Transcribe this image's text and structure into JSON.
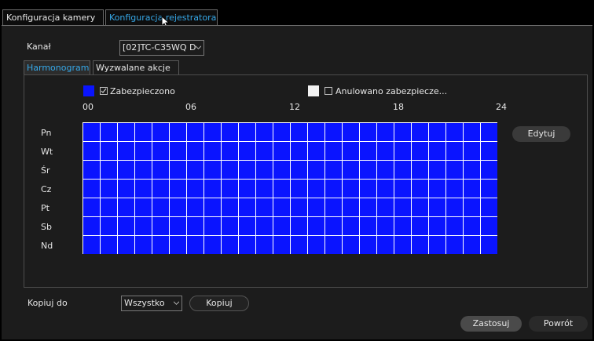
{
  "tabs": [
    {
      "label": "Konfiguracja kamery",
      "active": false
    },
    {
      "label": "Konfiguracja rejestratora",
      "active": true
    }
  ],
  "channel": {
    "label": "Kanał",
    "value": "[02]TC-C35WQ D"
  },
  "subtabs": [
    {
      "label": "Harmonogram",
      "active": true
    },
    {
      "label": "Wyzwalane akcje",
      "active": false
    }
  ],
  "legend": {
    "armed": {
      "label": "Zabezpieczono",
      "color": "#0a14ff",
      "checked": true
    },
    "disarmed": {
      "label": "Anulowano zabezpiecze...",
      "color": "#f2f2f2",
      "checked": false
    }
  },
  "hours": [
    "00",
    "06",
    "12",
    "18",
    "24"
  ],
  "days": [
    "Pn",
    "Wt",
    "Śr",
    "Cz",
    "Pt",
    "Sb",
    "Nd"
  ],
  "edit_label": "Edytuj",
  "copy": {
    "label": "Kopiuj do",
    "select_value": "Wszystko",
    "button": "Kopiuj"
  },
  "footer": {
    "apply": "Zastosuj",
    "back": "Powrót"
  },
  "colors": {
    "accent": "#36a8e8",
    "schedule_armed": "#0a14ff",
    "grid_line": "#ffffff"
  }
}
